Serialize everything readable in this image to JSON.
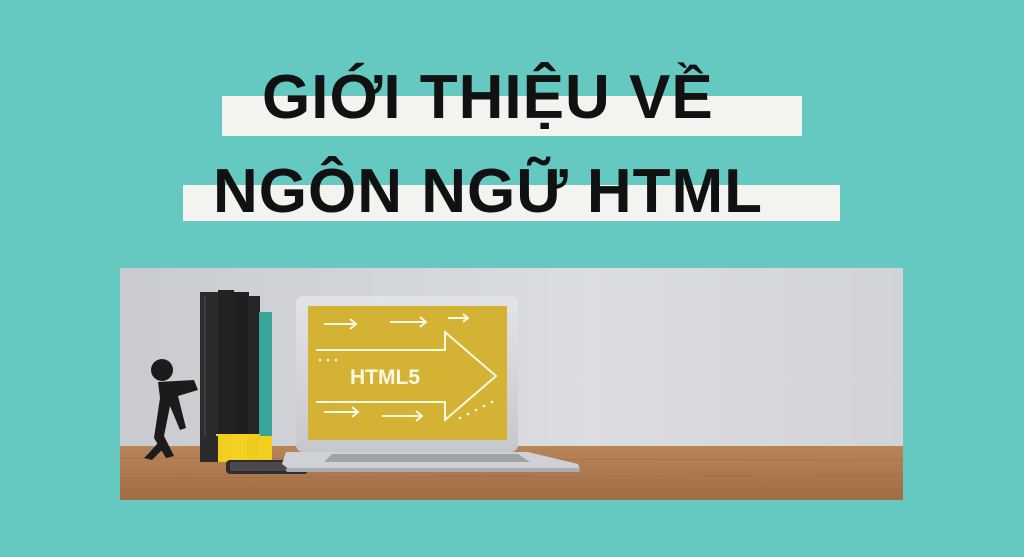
{
  "title": {
    "line1": "GIỚI THIỆU VỀ",
    "line2": "NGÔN NGỮ HTML"
  },
  "photo": {
    "screen_text": "HTML5"
  },
  "colors": {
    "background": "#65c9c2",
    "title_band": "#f3f4ef",
    "title_text": "#111111",
    "screen": "#d4b234"
  }
}
